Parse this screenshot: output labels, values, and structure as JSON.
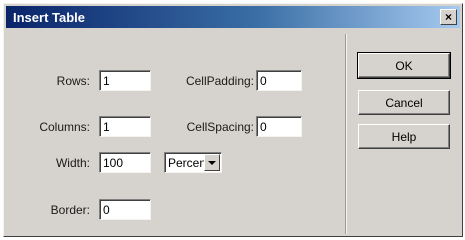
{
  "window": {
    "title": "Insert Table",
    "close_glyph": "×"
  },
  "form": {
    "rows": {
      "label": "Rows:",
      "value": "1"
    },
    "columns": {
      "label": "Columns:",
      "value": "1"
    },
    "width": {
      "label": "Width:",
      "value": "100"
    },
    "width_unit": {
      "selected": "Percent"
    },
    "border": {
      "label": "Border:",
      "value": "0"
    },
    "cell_padding": {
      "label": "CellPadding:",
      "value": "0"
    },
    "cell_spacing": {
      "label": "CellSpacing:",
      "value": "0"
    }
  },
  "buttons": {
    "ok": "OK",
    "cancel": "Cancel",
    "help": "Help"
  }
}
